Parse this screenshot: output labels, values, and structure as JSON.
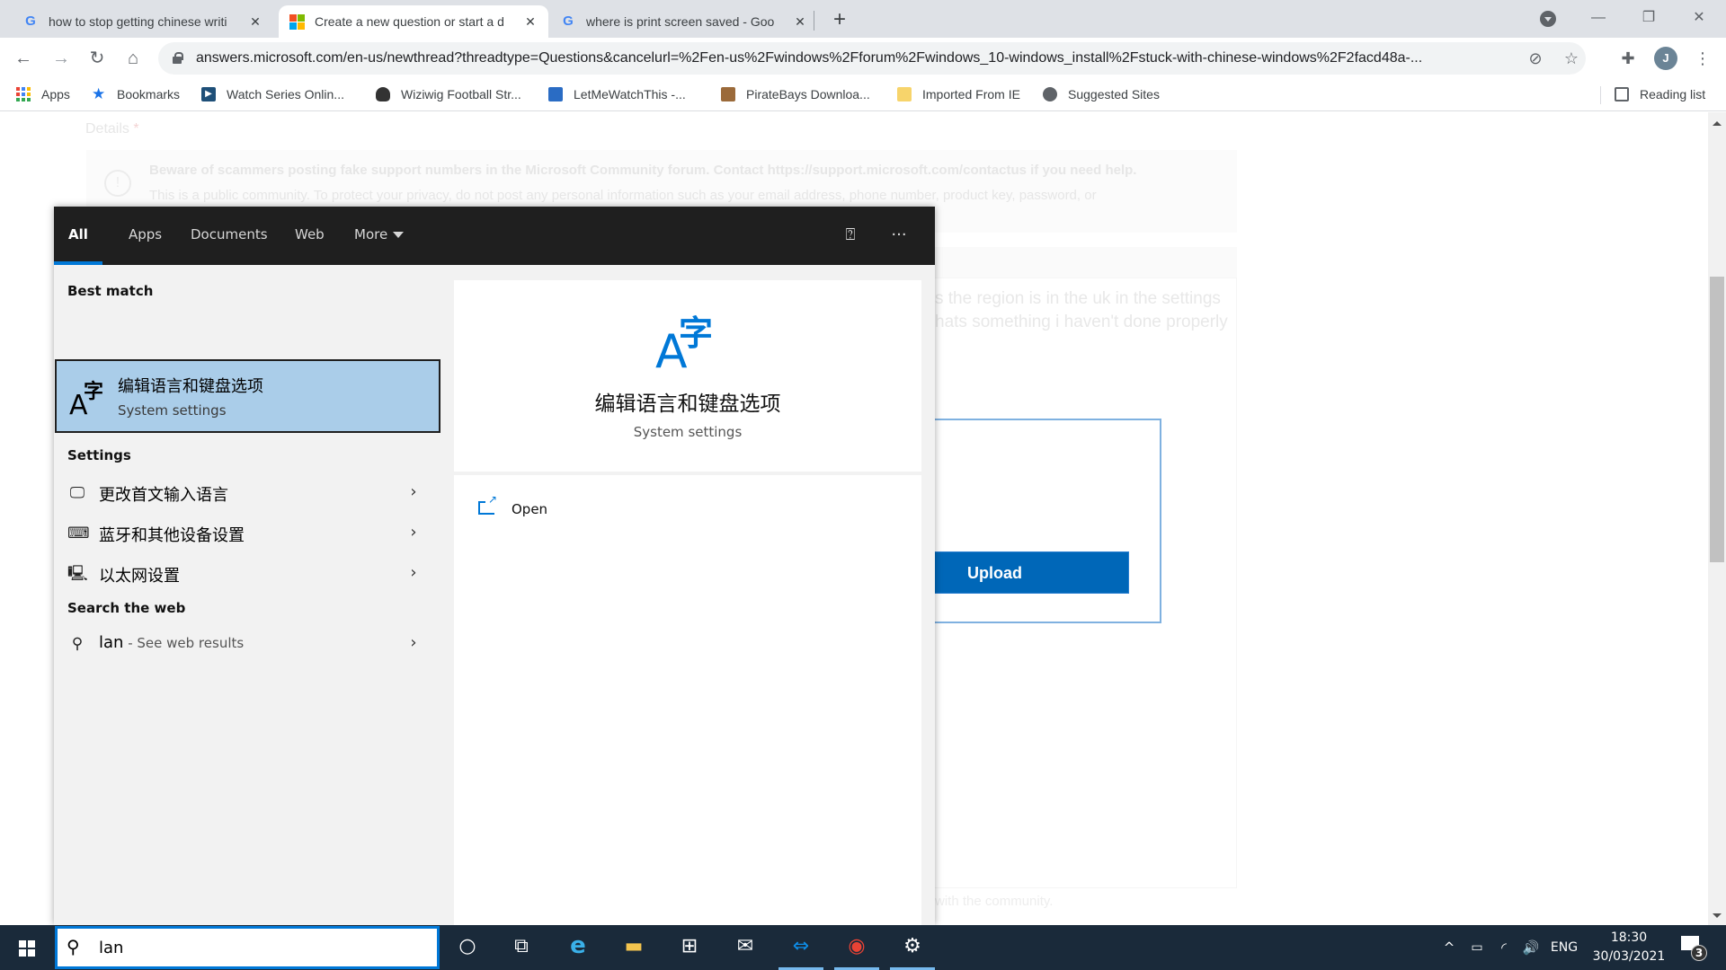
{
  "browser": {
    "tabs": [
      {
        "title": "how to stop getting chinese writi",
        "favicon": "google-icon",
        "active": false
      },
      {
        "title": "Create a new question or start a d",
        "favicon": "microsoft-icon",
        "active": true
      },
      {
        "title": "where is print screen saved - Goo",
        "favicon": "google-icon",
        "active": false
      }
    ],
    "new_tab_label": "+",
    "close_glyph": "✕",
    "url": "answers.microsoft.com/en-us/newthread?threadtype=Questions&cancelurl=%2Fen-us%2Fwindows%2Fforum%2Fwindows_10-windows_install%2Fstuck-with-chinese-windows%2F2facd48a-...",
    "profile_initial": "J",
    "bookmarks": [
      {
        "label": "Apps",
        "icon": "apps-grid-icon"
      },
      {
        "label": "Bookmarks",
        "icon": "star-icon"
      },
      {
        "label": "Watch Series Onlin...",
        "icon": "play-icon"
      },
      {
        "label": "Wiziwig Football Str...",
        "icon": "site-icon"
      },
      {
        "label": "LetMeWatchThis -...",
        "icon": "clapper-icon"
      },
      {
        "label": "PirateBays Downloa...",
        "icon": "ship-icon"
      },
      {
        "label": "Imported From IE",
        "icon": "folder-icon"
      },
      {
        "label": "Suggested Sites",
        "icon": "globe-icon"
      }
    ],
    "reading_list_label": "Reading list"
  },
  "page": {
    "details_label": "Details",
    "required_mark": "*",
    "notice_line1": "Beware of scammers posting fake support numbers in the Microsoft Community forum. Contact https://support.microsoft.com/contactus if you need help.",
    "notice_line2": "This is a public community. To protect your privacy, do not post any personal information such as your email address, phone number, product key, password, or",
    "body_line1": "s the region is in the uk in the settings",
    "body_line2": "hats something i haven't done properly",
    "body_line3": "with the community.",
    "upload_label": "Upload"
  },
  "search_panel": {
    "tabs": [
      {
        "label": "All",
        "active": true
      },
      {
        "label": "Apps",
        "active": false
      },
      {
        "label": "Documents",
        "active": false
      },
      {
        "label": "Web",
        "active": false
      },
      {
        "label": "More",
        "active": false
      }
    ],
    "feedback_icon": "feedback-icon",
    "more_options_glyph": "···",
    "best_match_heading": "Best match",
    "best_match": {
      "title": "编辑语言和键盘选项",
      "subtitle": "System settings",
      "icon_a": "A",
      "icon_zi": "字"
    },
    "settings_heading": "Settings",
    "settings_items": [
      {
        "label": "更改首文输入语言",
        "icon": "language-monitor-icon"
      },
      {
        "label": "蓝牙和其他设备设置",
        "icon": "devices-icon"
      },
      {
        "label": "以太网设置",
        "icon": "ethernet-icon"
      }
    ],
    "web_heading": "Search the web",
    "web_item": {
      "query": "lan",
      "suffix": " - See web results"
    },
    "chevron_glyph": "›",
    "preview": {
      "title": "编辑语言和键盘选项",
      "subtitle": "System settings",
      "actions": [
        {
          "label": "Open",
          "icon": "open-icon"
        }
      ]
    }
  },
  "taskbar": {
    "search_value": "lan",
    "apps": [
      {
        "name": "cortana",
        "glyph": "○",
        "running": false
      },
      {
        "name": "task-view",
        "glyph": "⧉",
        "running": false
      },
      {
        "name": "edge",
        "glyph": "e",
        "running": false
      },
      {
        "name": "file-explorer",
        "glyph": "▬",
        "running": false
      },
      {
        "name": "microsoft-store",
        "glyph": "⊞",
        "running": false
      },
      {
        "name": "mail",
        "glyph": "✉",
        "running": false
      },
      {
        "name": "teamviewer",
        "glyph": "⇔",
        "running": true
      },
      {
        "name": "chrome",
        "glyph": "◉",
        "running": true
      },
      {
        "name": "settings",
        "glyph": "⚙",
        "running": true
      }
    ],
    "tray": {
      "show_hidden_glyph": "^",
      "language": "ENG",
      "time": "18:30",
      "date": "30/03/2021",
      "notification_count": "3"
    }
  }
}
